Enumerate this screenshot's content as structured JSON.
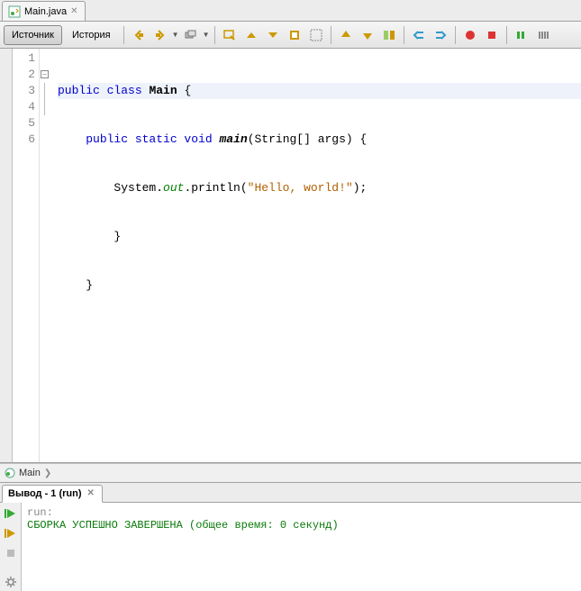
{
  "file_tab": {
    "name": "Main.java"
  },
  "toolbar": {
    "source": "Источник",
    "history": "История"
  },
  "code": {
    "lines": [
      {
        "n": 1,
        "kw1": "public",
        "kw2": "class",
        "cls": "Main",
        "rest": " {"
      },
      {
        "n": 2,
        "indent": "    ",
        "kws": "public static void",
        "mth": "main",
        "sig": "(String[] args) {"
      },
      {
        "n": 3,
        "indent": "        ",
        "pre": "System.",
        "fld": "out",
        "mid": ".println(",
        "str": "\"Hello, world!\"",
        "post": ");"
      },
      {
        "n": 4,
        "text": "        }"
      },
      {
        "n": 5,
        "text": "    }"
      },
      {
        "n": 6,
        "text": ""
      }
    ]
  },
  "breadcrumb": {
    "item": "Main"
  },
  "output": {
    "tab": "Вывод - 1 (run)",
    "line1": "run:",
    "line2": "СБОРКА УСПЕШНО ЗАВЕРШЕНА (общее время: 0 секунд)"
  }
}
